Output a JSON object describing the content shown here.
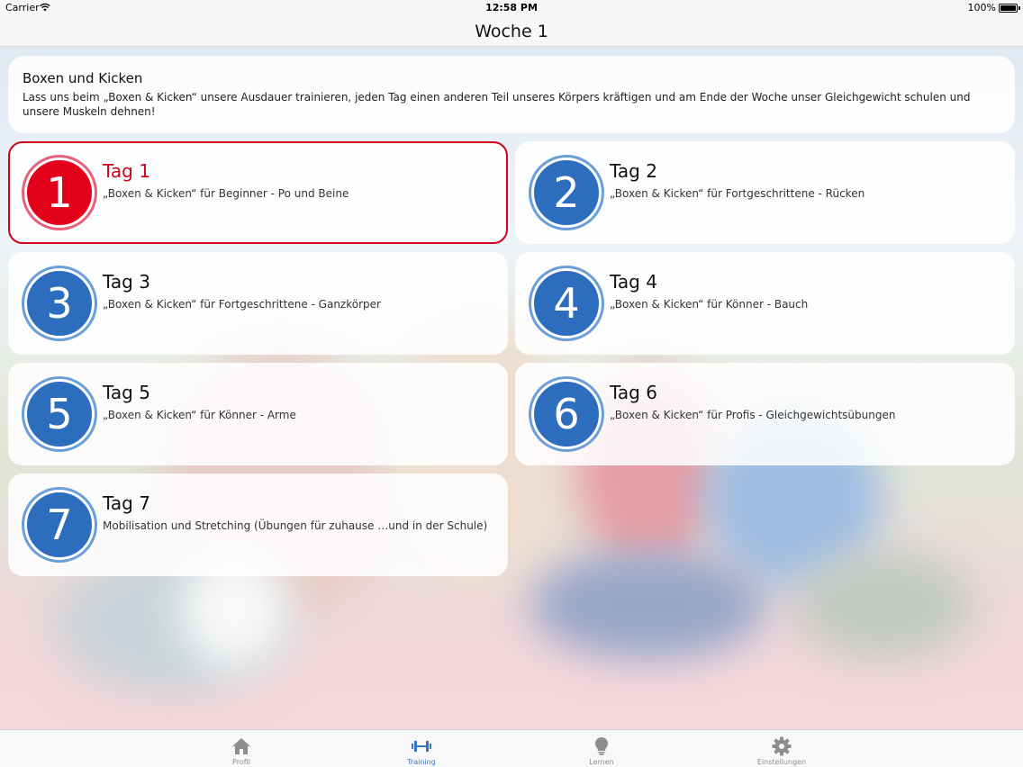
{
  "status_bar": {
    "carrier": "Carrier",
    "time": "12:58 PM",
    "battery": "100%"
  },
  "nav": {
    "title": "Woche 1"
  },
  "intro": {
    "title": "Boxen und Kicken",
    "text": "Lass uns beim „Boxen & Kicken“ unsere Ausdauer trainieren, jeden Tag einen anderen Teil unseres Körpers kräftigen und am Ende der Woche unser Gleichgewicht schulen und unsere Muskeln dehnen!"
  },
  "days": [
    {
      "number": "1",
      "title": "Tag 1",
      "subtitle": "„Boxen & Kicken“ für Beginner - Po und Beine",
      "selected": true
    },
    {
      "number": "2",
      "title": "Tag 2",
      "subtitle": "„Boxen & Kicken“ für Fortgeschrittene - Rücken",
      "selected": false
    },
    {
      "number": "3",
      "title": "Tag 3",
      "subtitle": "„Boxen & Kicken“ für Fortgeschrittene - Ganzkörper",
      "selected": false
    },
    {
      "number": "4",
      "title": "Tag 4",
      "subtitle": "„Boxen & Kicken“ für Könner - Bauch",
      "selected": false
    },
    {
      "number": "5",
      "title": "Tag 5",
      "subtitle": "„Boxen & Kicken“ für Könner - Arme",
      "selected": false
    },
    {
      "number": "6",
      "title": "Tag 6",
      "subtitle": "„Boxen & Kicken“ für Profis - Gleichgewichtsübungen",
      "selected": false
    },
    {
      "number": "7",
      "title": "Tag 7",
      "subtitle": "Mobilisation und Stretching (Übungen für zuhause …und in der Schule)",
      "selected": false
    }
  ],
  "tabs": [
    {
      "label": "Profil",
      "icon": "home-icon",
      "selected": false
    },
    {
      "label": "Training",
      "icon": "dumbbell-icon",
      "selected": true
    },
    {
      "label": "Lernen",
      "icon": "lightbulb-icon",
      "selected": false
    },
    {
      "label": "Einstellungen",
      "icon": "gear-icon",
      "selected": false
    }
  ],
  "colors": {
    "accent_red": "#d0021b",
    "circle_blue": "#2c6dbe",
    "tab_active": "#3a73c4",
    "tab_inactive": "#8e8e8e"
  }
}
